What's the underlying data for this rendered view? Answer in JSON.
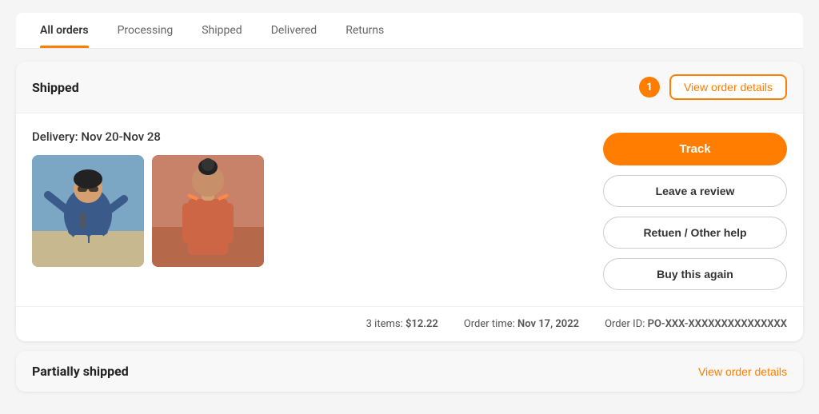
{
  "tabs": [
    {
      "id": "all-orders",
      "label": "All orders",
      "active": true
    },
    {
      "id": "processing",
      "label": "Processing",
      "active": false
    },
    {
      "id": "shipped",
      "label": "Shipped",
      "active": false
    },
    {
      "id": "delivered",
      "label": "Delivered",
      "active": false
    },
    {
      "id": "returns",
      "label": "Returns",
      "active": false
    }
  ],
  "order_card": {
    "status": "Shipped",
    "badge_count": "1",
    "view_order_label": "View order details",
    "delivery_text": "Delivery: Nov 20-Nov 28",
    "btn_track": "Track",
    "btn_review": "Leave a review",
    "btn_return": "Retuen / Other help",
    "btn_buy_again": "Buy this again",
    "footer": {
      "items_count": "3 items:",
      "items_price": "$12.22",
      "order_time_label": "Order time:",
      "order_time_value": "Nov 17, 2022",
      "order_id_label": "Order ID:",
      "order_id_value": "PO-XXX-XXXXXXXXXXXXXXX"
    }
  },
  "partial_card": {
    "status": "Partially shipped",
    "view_order_label": "View order details"
  },
  "colors": {
    "accent": "#ff7d00",
    "border_accent": "#ff7d00"
  }
}
